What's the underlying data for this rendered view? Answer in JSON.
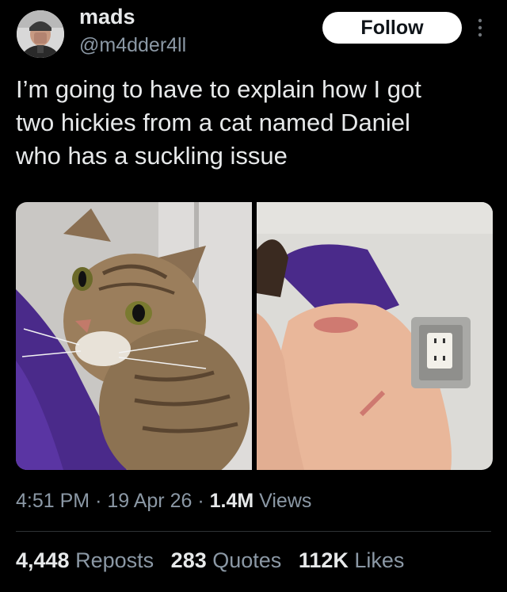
{
  "author": {
    "display_name": "mads",
    "handle": "@m4dder4ll",
    "avatar_icon": "avatar-photo"
  },
  "header": {
    "follow_label": "Follow",
    "more_icon": "more-vertical-icon"
  },
  "tweet": {
    "text": "I’m going to have to explain how I got\ntwo hickies from a cat named Daniel\nwho has a suckling issue"
  },
  "media": {
    "photos": [
      {
        "subject": "tabby-cat-photo"
      },
      {
        "subject": "arm-with-hickies-photo"
      }
    ]
  },
  "meta": {
    "time": "4:51 PM",
    "separator": "·",
    "date": "19 Apr 26",
    "views_count": "1.4M",
    "views_label": "Views"
  },
  "stats": {
    "reposts_count": "4,448",
    "reposts_label": "Reposts",
    "quotes_count": "283",
    "quotes_label": "Quotes",
    "likes_count": "112K",
    "likes_label": "Likes"
  },
  "colors": {
    "background": "#000000",
    "primary_text": "#e7e9ea",
    "secondary_text": "#8b98a5",
    "follow_bg": "#ffffff"
  }
}
